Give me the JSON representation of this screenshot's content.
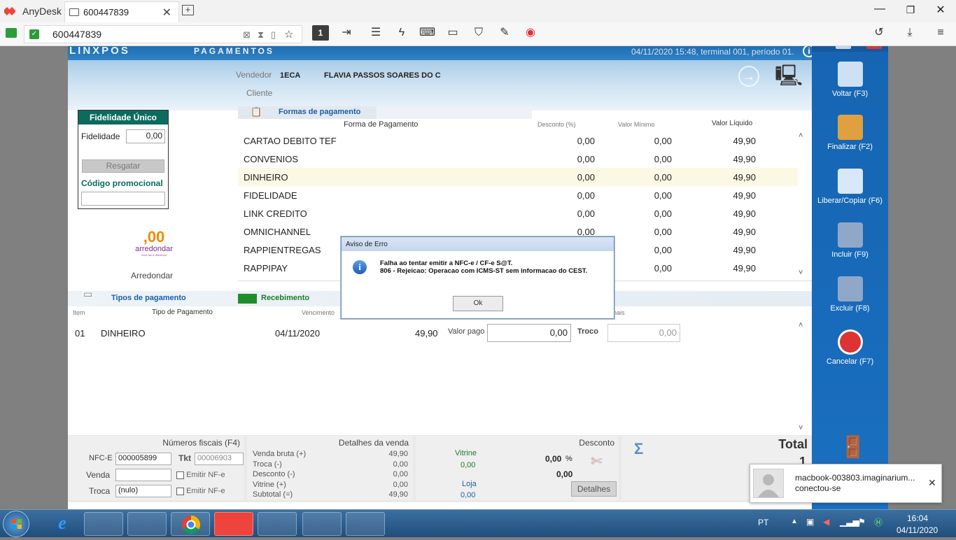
{
  "anydesk": {
    "app_name": "AnyDesk",
    "tab_title": "600447839",
    "address": "600447839",
    "display_number": "1"
  },
  "app_header": {
    "logo": "LINXPOS",
    "title": "PAGAMENTOS",
    "info": "04/11/2020 15:48, terminal 001, período 01."
  },
  "sale": {
    "vendedor_label": "Vendedor",
    "vendedor_code": "1ECA",
    "vendedor_name": "FLAVIA PASSOS SOARES DO C",
    "cliente_label": "Cliente"
  },
  "fidelidade": {
    "title": "Fidelidade Único",
    "label": "Fidelidade",
    "value": "0,00",
    "resgatar": "Resgatar",
    "promo_label": "Código promocional",
    "promo_value": ""
  },
  "arredondar": {
    "amount": ",00",
    "brand": "arredondar",
    "tagline": "você faz a diferença",
    "link": "Arredondar"
  },
  "formas": {
    "tab_label": "Formas de pagamento",
    "headers": {
      "forma": "Forma de Pagamento",
      "desconto": "Desconto (%)",
      "valor_minimo": "Valor Mínimo",
      "valor_liquido": "Valor Líquido"
    },
    "rows": [
      {
        "forma": "CARTAO DEBITO TEF",
        "desconto": "0,00",
        "minimo": "0,00",
        "liquido": "49,90"
      },
      {
        "forma": "CONVENIOS",
        "desconto": "0,00",
        "minimo": "0,00",
        "liquido": "49,90"
      },
      {
        "forma": "DINHEIRO",
        "desconto": "0,00",
        "minimo": "0,00",
        "liquido": "49,90"
      },
      {
        "forma": "FIDELIDADE",
        "desconto": "0,00",
        "minimo": "0,00",
        "liquido": "49,90"
      },
      {
        "forma": "LINK CREDITO",
        "desconto": "0,00",
        "minimo": "0,00",
        "liquido": "49,90"
      },
      {
        "forma": "OMNICHANNEL",
        "desconto": "0,00",
        "minimo": "0,00",
        "liquido": "49,90"
      },
      {
        "forma": "RAPPIENTREGAS",
        "desconto": "0,00",
        "minimo": "0,00",
        "liquido": "49,90"
      },
      {
        "forma": "RAPPIPAY",
        "desconto": "0,00",
        "minimo": "0,00",
        "liquido": "49,90"
      }
    ]
  },
  "pagamento": {
    "tab_tipos": "Tipos de pagamento",
    "tab_recebimento": "Recebimento",
    "headers": {
      "item": "Item",
      "tipo": "Tipo de Pagamento",
      "vencimento": "Vencimento",
      "extra": "nais"
    },
    "row": {
      "item": "01",
      "tipo": "DINHEIRO",
      "vencimento": "04/11/2020",
      "valor": "49,90"
    },
    "valor_pago_label": "Valor pago",
    "valor_pago": "0,00",
    "troco_label": "Troco",
    "troco": "0,00"
  },
  "numeros_fiscais": {
    "title": "Números fiscais (F4)",
    "nfce_label": "NFC-E",
    "nfce_value": "000005899",
    "tkt_label": "Tkt",
    "tkt_value": "00006903",
    "venda_label": "Venda",
    "troca_label": "Troca",
    "troca_value": "(nulo)",
    "emitir1": "Emitir NF-e",
    "emitir2": "Emitir NF-e"
  },
  "detalhes_venda": {
    "title": "Detalhes da venda",
    "rows": [
      {
        "label": "Venda bruta (+)",
        "value": "49,90"
      },
      {
        "label": "Troca (-)",
        "value": "0,00"
      },
      {
        "label": "Desconto (-)",
        "value": "0,00"
      },
      {
        "label": "Vitrine (+)",
        "value": "0,00"
      },
      {
        "label": "Subtotal (=)",
        "value": "49,90"
      }
    ]
  },
  "desconto": {
    "title": "Desconto",
    "vitrine_label": "Vitrine",
    "vitrine_value": "0,00",
    "pct": "0,00",
    "pct_sign": "%",
    "amount": "0,00",
    "loja_label": "Loja",
    "loja_value": "0,00",
    "detalhes": "Detalhes"
  },
  "total": {
    "title": "Total",
    "value": "1"
  },
  "sidebar": [
    {
      "label": "Voltar (F3)",
      "icon": "back-arrow-icon"
    },
    {
      "label": "Finalizar (F2)",
      "icon": "shopping-bag-icon"
    },
    {
      "label": "Liberar/Copiar (F6)",
      "icon": "copy-document-icon"
    },
    {
      "label": "Incluir (F9)",
      "icon": "add-register-icon"
    },
    {
      "label": "Excluir (F8)",
      "icon": "remove-register-icon"
    },
    {
      "label": "Cancelar (F7)",
      "icon": "cancel-icon"
    }
  ],
  "dialog": {
    "title": "Aviso de Erro",
    "line1": "Falha ao tentar emitir a NFC-e / CF-e S@T.",
    "line2": "806 - Rejeicao: Operacao com ICMS-ST sem informacao do CEST.",
    "ok": "Ok"
  },
  "toast": {
    "line1": "macbook-003803.imaginarium...",
    "line2": "conectou-se"
  },
  "taskbar": {
    "lang": "PT",
    "time": "16:04",
    "date": "04/11/2020"
  },
  "colors": {
    "sidebar_blue": "#1a6fbf",
    "header_blue": "#1d6eb0",
    "fid_green": "#0c6b5e",
    "anydesk_red": "#ef443b"
  }
}
